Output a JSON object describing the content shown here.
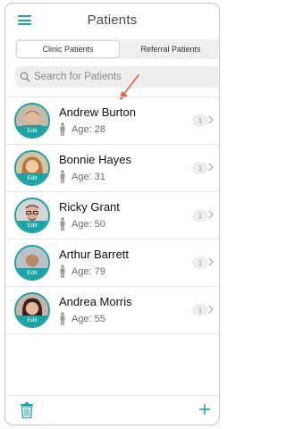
{
  "header": {
    "title": "Patients"
  },
  "tabs": [
    {
      "label": "Clinic Patients",
      "active": true
    },
    {
      "label": "Referral Patients",
      "active": false
    }
  ],
  "search": {
    "placeholder": "Search for Patients"
  },
  "patients": [
    {
      "name": "Andrew Burton",
      "age": "Age: 28",
      "badge": "1",
      "edit": "Edit",
      "avatar": "male-avatar"
    },
    {
      "name": "Bonnie Hayes",
      "age": "Age: 31",
      "badge": "1",
      "edit": "Edit",
      "avatar": "female-avatar"
    },
    {
      "name": "Ricky Grant",
      "age": "Age: 50",
      "badge": "1",
      "edit": "Edit",
      "avatar": "male-glasses-avatar"
    },
    {
      "name": "Arthur Barrett",
      "age": "Age: 79",
      "badge": "1",
      "edit": "Edit",
      "avatar": "elderly-male-avatar"
    },
    {
      "name": "Andrea Morris",
      "age": "Age: 55",
      "badge": "1",
      "edit": "Edit",
      "avatar": "female-avatar"
    }
  ],
  "colors": {
    "accent": "#1ba3a5",
    "annotation_arrow": "#e06050"
  },
  "icons": {
    "menu": "hamburger-icon",
    "search": "search-icon",
    "delete": "trash-icon",
    "add": "plus-icon"
  }
}
